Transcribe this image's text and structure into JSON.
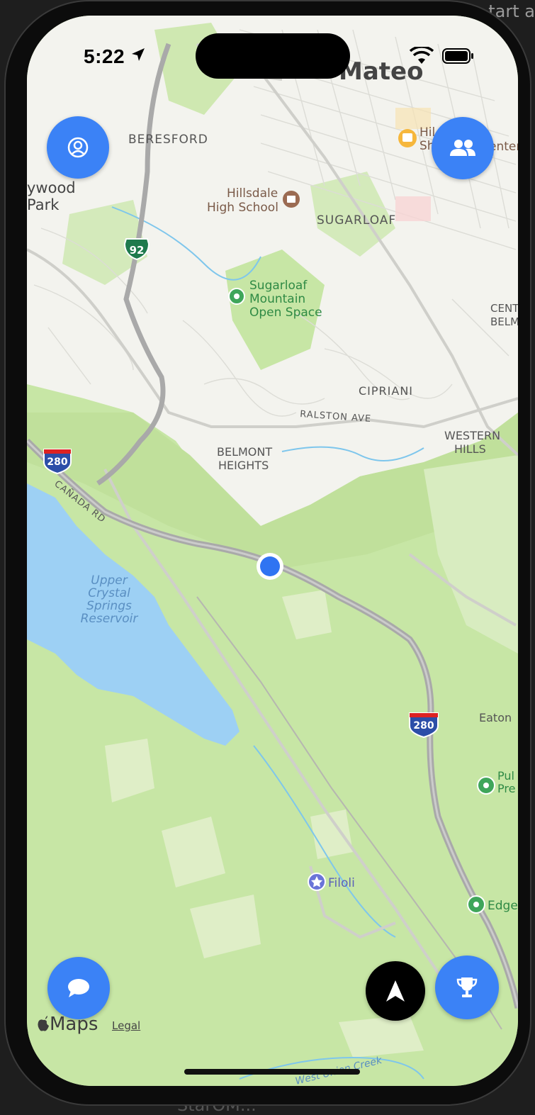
{
  "desktop": {
    "corner_text": "tart a",
    "bottom_text": "StarOM..."
  },
  "status_bar": {
    "time": "5:22"
  },
  "map": {
    "labels": {
      "city": "Mateo",
      "beresford": "BERESFORD",
      "hollywood_1": "ywood",
      "hollywood_2": "Park",
      "hillsdale_1": "Hillsdale",
      "hillsdale_2": "High School",
      "sugarloaf": "SUGARLOAF",
      "hwy92": "92",
      "openspace_1": "Sugarloaf",
      "openspace_2": "Mountain",
      "openspace_3": "Open Space",
      "central_1": "CENT",
      "central_2": "BELM",
      "cipriani": "CIPRIANI",
      "ralston": "RALSTON AVE",
      "western_1": "WESTERN",
      "western_2": "HILLS",
      "belmont_1": "BELMONT",
      "belmont_2": "HEIGHTS",
      "i280_a": "280",
      "i280_b": "280",
      "canada": "CAÑADA RD",
      "res_1": "Upper",
      "res_2": "Crystal",
      "res_3": "Springs",
      "res_4": "Reservoir",
      "eaton": "Eaton",
      "pulgas_1": "Pul",
      "pulgas_2": "Pre",
      "filoli": "Filoli",
      "edgewood": "Edge",
      "union_creek": "West Union Creek",
      "hillsdale_center_1": "Hil",
      "hillsdale_center_2": "Sh",
      "center_suffix": "enter"
    }
  },
  "buttons": {
    "profile": "profile",
    "friends": "friends",
    "chat": "chat",
    "recenter": "recenter",
    "trophy": "trophy"
  },
  "footer": {
    "maps": "Maps",
    "legal": "Legal"
  },
  "colors": {
    "accent": "#3b82f6",
    "land": "#c7e6a5",
    "urban": "#f4f4ef",
    "water": "#9dd0f4",
    "highway": "#a9a9a9"
  }
}
